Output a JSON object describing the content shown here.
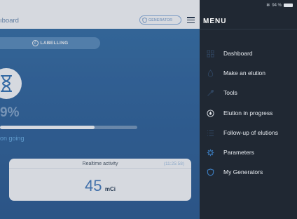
{
  "app": {
    "title": "ıboard",
    "generator_button": "GENERATOR",
    "step": {
      "number": "2",
      "label": "LABELLING"
    },
    "percent": "9%",
    "progress": 0.69,
    "status_text": "on going",
    "card": {
      "title": "Realtime activity",
      "time": "(11:25:58)",
      "value": "45",
      "unit": "mCi"
    }
  },
  "menu": {
    "title": "MENU",
    "status_bar": {
      "battery_text": "94 %"
    },
    "items": [
      {
        "label": "Dashboard",
        "icon": "grid-icon"
      },
      {
        "label": "Make an elution",
        "icon": "drop-icon"
      },
      {
        "label": "Tools",
        "icon": "wrench-icon"
      },
      {
        "label": "Elution in progress",
        "icon": "drop-circle-icon"
      },
      {
        "label": "Follow-up of elutions",
        "icon": "list-icon"
      },
      {
        "label": "Parameters",
        "icon": "gear-icon"
      },
      {
        "label": "My Generators",
        "icon": "shield-icon"
      }
    ]
  },
  "colors": {
    "accent": "#3a78b8",
    "menu_bg": "#202833",
    "icon_dim": "#2f4560"
  }
}
